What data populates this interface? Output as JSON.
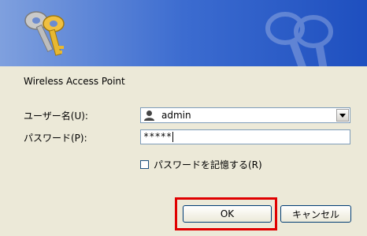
{
  "dialog": {
    "site_name": "Wireless Access Point"
  },
  "fields": {
    "username_label": "ユーザー名(U):",
    "username_value": "admin",
    "password_label": "パスワード(P):",
    "password_value": "*****"
  },
  "remember": {
    "label": "パスワードを記憶する(R)",
    "checked": false
  },
  "buttons": {
    "ok": "OK",
    "cancel": "キャンセル"
  },
  "colors": {
    "banner_start": "#7fa0de",
    "banner_end": "#1e4fbf",
    "highlight": "#e00000"
  },
  "icons": {
    "banner": "keys-icon",
    "user": "user-icon",
    "combo": "chevron-down-icon"
  }
}
